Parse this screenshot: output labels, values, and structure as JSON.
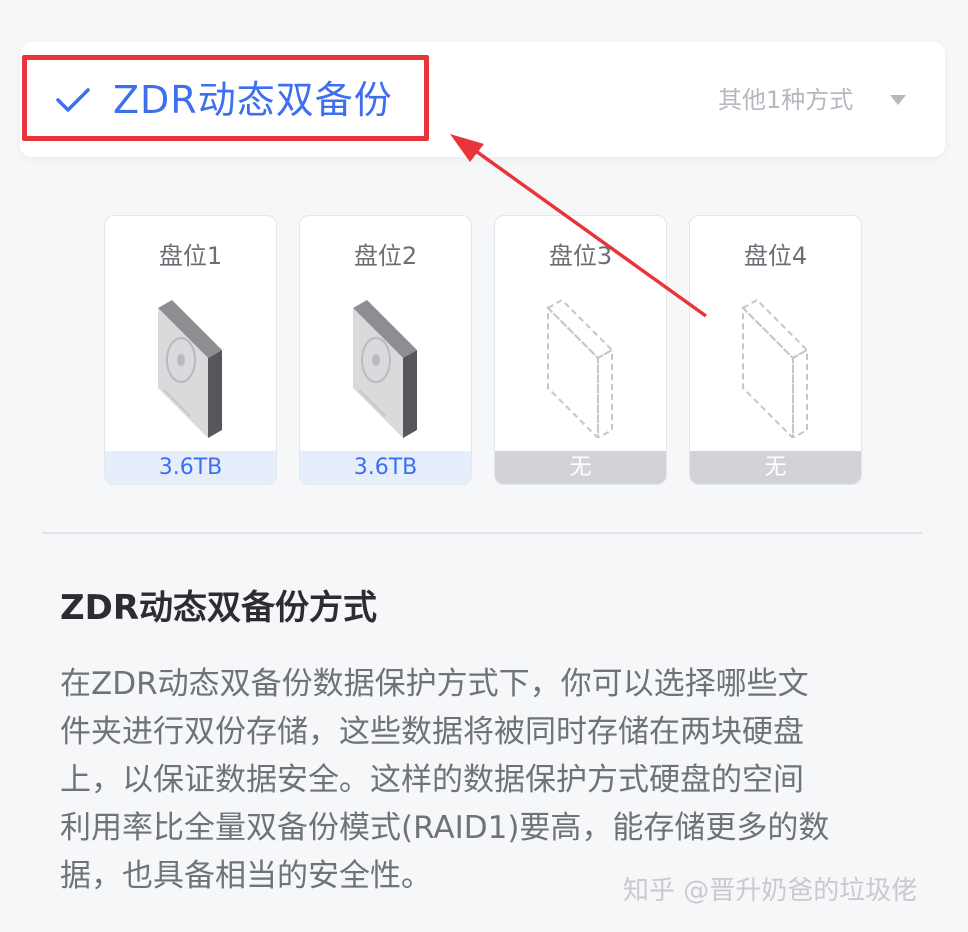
{
  "mode": {
    "title": "ZDR动态双备份",
    "other_modes": "其他1种方式",
    "accent_color": "#3e6ff0",
    "highlight_color": "#e8353b"
  },
  "slots": [
    {
      "label": "盘位1",
      "capacity": "3.6TB",
      "status": "filled"
    },
    {
      "label": "盘位2",
      "capacity": "3.6TB",
      "status": "filled"
    },
    {
      "label": "盘位3",
      "capacity": "无",
      "status": "empty"
    },
    {
      "label": "盘位4",
      "capacity": "无",
      "status": "empty"
    }
  ],
  "section": {
    "title": "ZDR动态双备份方式",
    "description_lines": [
      "在ZDR动态双备份数据保护方式下，你可以选择哪些文",
      "件夹进行双份存储，这些数据将被同时存储在两块硬盘",
      "上，以保证数据安全。这样的数据保护方式硬盘的空间",
      "利用率比全量双备份模式(RAID1)要高，能存储更多的数",
      "据，也具备相当的安全性。"
    ]
  },
  "watermark": "知乎 @晋升奶爸的垃圾佬",
  "icons": {
    "check": "check-icon",
    "dropdown": "triangle-down-icon",
    "disk": "hard-disk-icon",
    "empty_disk": "empty-disk-outline-icon"
  }
}
